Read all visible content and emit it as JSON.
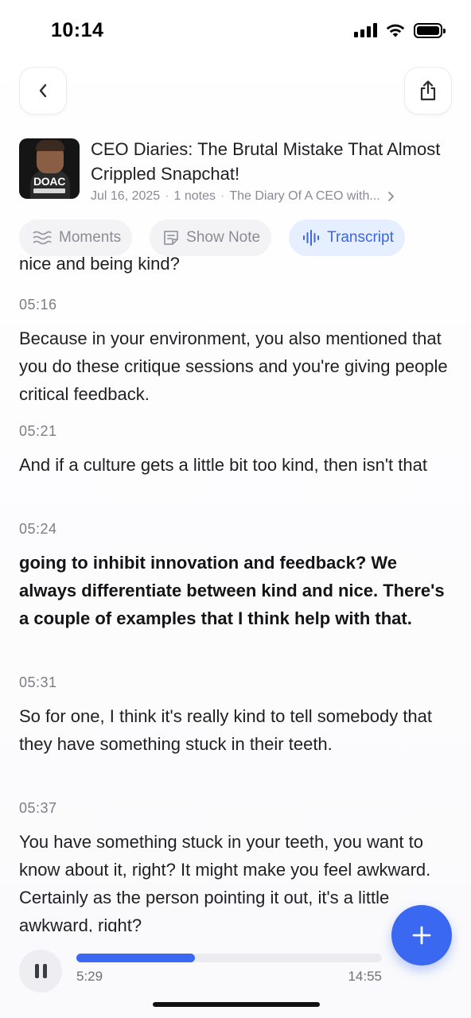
{
  "status_bar": {
    "time": "10:14",
    "icons": [
      "cellular-signal-icon",
      "wifi-icon",
      "battery-icon"
    ]
  },
  "nav": {
    "back_icon": "chevron-left-icon",
    "share_icon": "share-icon"
  },
  "episode": {
    "cover_text": "DOAC",
    "title": "CEO Diaries: The Brutal Mistake That Almost Crippled Snapchat!",
    "date": "Jul 16, 2025",
    "notes": "1 notes",
    "podcast": "The Diary Of A CEO with...",
    "separator": "·"
  },
  "tabs": [
    {
      "label": "Moments",
      "icon": "moments-icon",
      "active": false
    },
    {
      "label": "Show Note",
      "icon": "notes-icon",
      "active": false
    },
    {
      "label": "Transcript",
      "icon": "waveform-icon",
      "active": true
    }
  ],
  "transcript": {
    "cut_top_text": "nice and being kind?",
    "segments": [
      {
        "time": "05:16",
        "text": "Because in your environment, you also mentioned that you do these critique sessions and you're giving people critical feedback.",
        "current": false
      },
      {
        "time": "05:21",
        "text": "And if a culture gets a little bit too kind, then isn't that",
        "current": false
      },
      {
        "time": "05:24",
        "text": "going to inhibit innovation and feedback? We always differentiate between kind and nice. There's a couple of examples that I think help with that.",
        "current": true
      },
      {
        "time": "05:31",
        "text": "So for one, I think it's really kind to tell somebody that they have something stuck in their teeth.",
        "current": false
      },
      {
        "time": "05:37",
        "text": "You have something stuck in your teeth, you want to know about it, right? It might make you feel awkward. Certainly as the person pointing it out, it's a little awkward, right?",
        "current": false
      }
    ]
  },
  "fab": {
    "icon": "plus-icon"
  },
  "player": {
    "current_time": "5:29",
    "total_time": "14:55",
    "progress": 0.388,
    "state_icon": "pause-icon"
  },
  "colors": {
    "accent": "#3b68f0",
    "tab_active_bg": "#e6efff",
    "text_primary": "#1f1f23",
    "text_secondary": "#8a8a95"
  }
}
